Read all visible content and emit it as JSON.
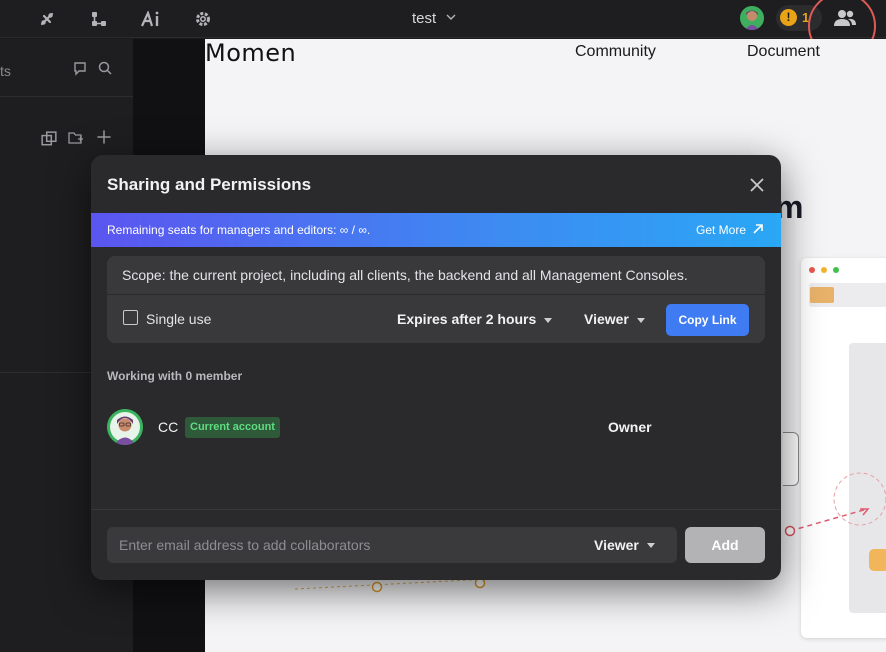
{
  "topbar": {
    "project_title": "test",
    "notification_count": "1",
    "notification_badge": "!",
    "icons": [
      "plugin-icon",
      "branch-icon",
      "ai-icon",
      "settings-icon",
      "users-icon"
    ]
  },
  "left_panel": {
    "tab_text": "ts"
  },
  "site_preview": {
    "logo": "Momen",
    "nav": [
      "Community",
      "Document"
    ],
    "headline_fragment": "m"
  },
  "dialog": {
    "title": "Sharing and Permissions",
    "banner": {
      "text": "Remaining seats for managers and editors: ∞ / ∞.",
      "get_more": "Get More"
    },
    "scope_text": "Scope: the current project, including all clients, the backend and all Management Consoles.",
    "single_use_label": "Single use",
    "expiry_select": "Expires after 2 hours",
    "role_select": "Viewer",
    "copy_link": "Copy Link",
    "working_with": "Working with 0 member",
    "members": [
      {
        "name": "CC",
        "badge": "Current account",
        "role": "Owner"
      }
    ],
    "footer": {
      "email_placeholder": "Enter email address to add collaborators",
      "role_select": "Viewer",
      "add": "Add"
    }
  },
  "colors": {
    "accent_blue": "#3f7bf2",
    "banner_start": "#5b55f0",
    "banner_end": "#2aa7f5",
    "badge_green": "#5fdc82",
    "warning": "#e8a317",
    "highlight_ring": "#e05a55"
  }
}
